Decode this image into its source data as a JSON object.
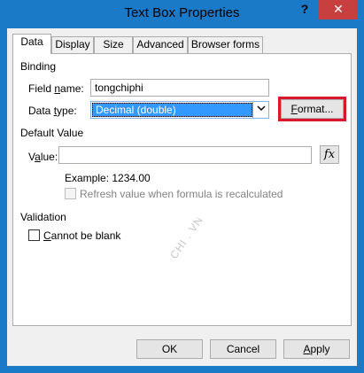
{
  "window": {
    "title": "Text Box Properties",
    "help_glyph": "?",
    "close_glyph": "✕"
  },
  "tabs": [
    {
      "label": "Data",
      "active": true
    },
    {
      "label": "Display",
      "active": false
    },
    {
      "label": "Size",
      "active": false
    },
    {
      "label": "Advanced",
      "active": false
    },
    {
      "label": "Browser forms",
      "active": false
    }
  ],
  "binding": {
    "section_label": "Binding",
    "field_name_label_pre": "Field ",
    "field_name_label_acc": "n",
    "field_name_label_post": "ame:",
    "field_name_value": "tongchiphi",
    "data_type_label_pre": "Data ",
    "data_type_label_acc": "t",
    "data_type_label_post": "ype:",
    "data_type_value": "Decimal (double)",
    "format_button_acc": "F",
    "format_button_rest": "ormat..."
  },
  "default_value": {
    "section_label": "Default Value",
    "value_label_pre": "V",
    "value_label_acc": "a",
    "value_label_post": "lue:",
    "value": "",
    "fx_label": "fx",
    "example_text": "Example: 1234.00",
    "refresh_label": "Refresh value when formula is recalculated"
  },
  "validation": {
    "section_label": "Validation",
    "cannot_be_blank_acc": "C",
    "cannot_be_blank_rest": "annot be blank"
  },
  "watermark": "CHI . VN",
  "footer": {
    "ok_label": "OK",
    "cancel_label": "Cancel",
    "apply_acc": "A",
    "apply_rest": "pply"
  },
  "colors": {
    "titlebar": "#1b7ac8",
    "close_button": "#c73f3f",
    "highlight_box": "#d9182d",
    "selection": "#3399ff"
  }
}
